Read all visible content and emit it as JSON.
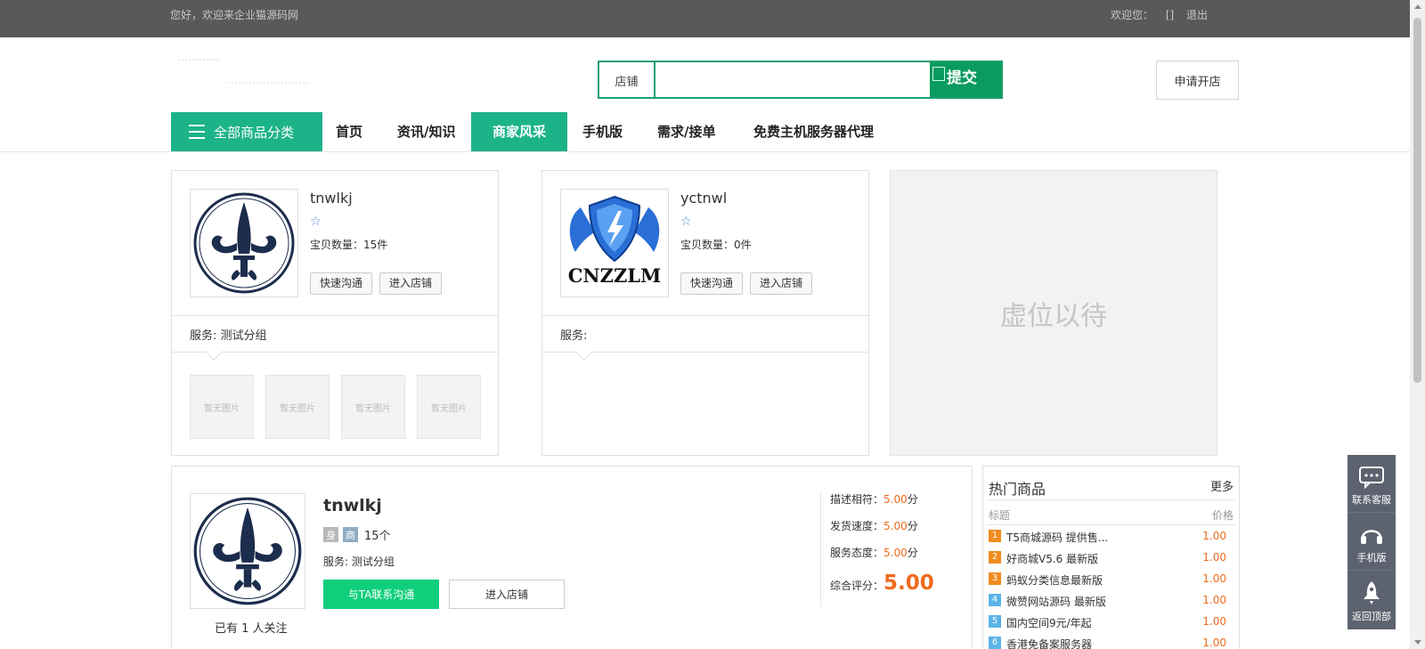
{
  "topbar": {
    "welcome": "您好，欢迎来企业猫源码网",
    "user_greeting": "欢迎您：",
    "user_name": "[]",
    "logout": "退出"
  },
  "search": {
    "scope": "店铺",
    "value": "",
    "placeholder": "",
    "submit_label": "提交"
  },
  "header": {
    "apply_shop": "申请开店"
  },
  "nav": {
    "category_button": "全部商品分类",
    "items": [
      "首页",
      "资讯/知识",
      "商家风采",
      "手机版",
      "需求/接单",
      "免费主机服务器代理"
    ],
    "active": "商家风采"
  },
  "shops": [
    {
      "name": "tnwlkj",
      "rating_star": "☆",
      "count_label": "宝贝数量：15件",
      "chat_btn": "快速沟通",
      "enter_btn": "进入店铺",
      "service": "服务: 测试分组",
      "thumbs": [
        "暂无图片",
        "暂无图片",
        "暂无图片",
        "暂无图片"
      ]
    },
    {
      "name": "yctnwl",
      "rating_star": "☆",
      "count_label": "宝贝数量：0件",
      "chat_btn": "快速沟通",
      "enter_btn": "进入店铺",
      "service": "服务:",
      "logo_text": "CNZZLM"
    }
  ],
  "placeholder": {
    "text": "虚位以待"
  },
  "detail": {
    "name": "tnwlkj",
    "badge1": "身",
    "badge2": "商",
    "count": "15个",
    "service": "服务: 测试分组",
    "contact_btn": "与TA联系沟通",
    "enter_btn": "进入店铺",
    "follow": "已有 1 人关注",
    "ratings": [
      {
        "label": "描述相符：",
        "value": "5.00",
        "unit": "分"
      },
      {
        "label": "发货速度：",
        "value": "5.00",
        "unit": "分"
      },
      {
        "label": "服务态度：",
        "value": "5.00",
        "unit": "分"
      }
    ],
    "total_label": "综合评分：",
    "total_value": "5.00"
  },
  "hot": {
    "title": "热门商品",
    "more": "更多",
    "col_title": "标题",
    "col_price": "价格",
    "items": [
      {
        "num": "1",
        "name": "T5商城源码 提供售...",
        "price": "1.00",
        "color": "#f08b1e"
      },
      {
        "num": "2",
        "name": "好商城V5.6 最新版",
        "price": "1.00",
        "color": "#f08b1e"
      },
      {
        "num": "3",
        "name": "蚂蚁分类信息最新版",
        "price": "1.00",
        "color": "#f08b1e"
      },
      {
        "num": "4",
        "name": "微赞网站源码 最新版",
        "price": "1.00",
        "color": "#5ab4e8"
      },
      {
        "num": "5",
        "name": "国内空间9元/年起",
        "price": "1.00",
        "color": "#5ab4e8"
      },
      {
        "num": "6",
        "name": "香港免备案服务器",
        "price": "1.00",
        "color": "#5ab4e8"
      }
    ]
  },
  "side_tools": {
    "service": "联系客服",
    "mobile": "手机版",
    "top": "返回顶部"
  },
  "colors": {
    "accent": "#1db389",
    "search_border": "#1a9f6d",
    "price": "#ee6a1d",
    "topbar": "#595959"
  }
}
